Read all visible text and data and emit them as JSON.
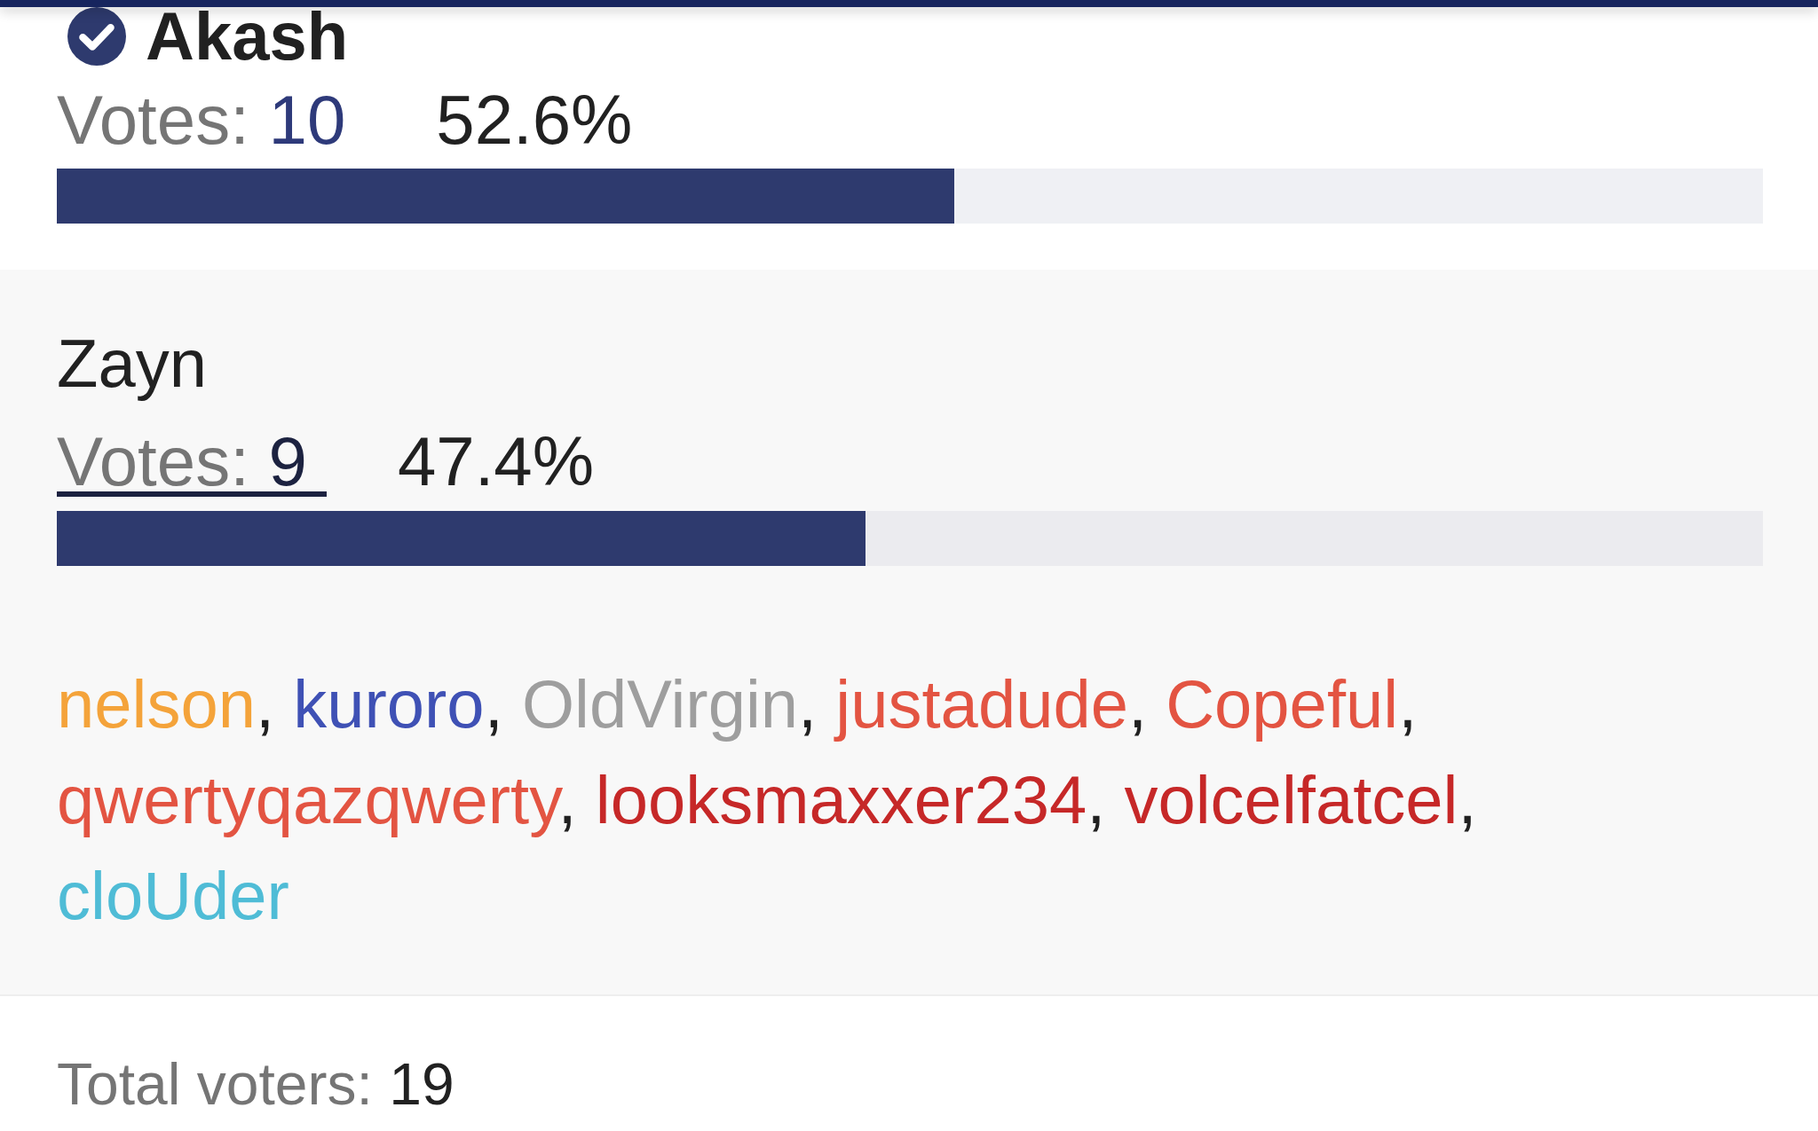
{
  "options": [
    {
      "name": "Akash",
      "selected": true,
      "expanded": false,
      "votes_label": "Votes:",
      "votes": "10",
      "percent": "52.6%",
      "level": 0.526
    },
    {
      "name": "Zayn",
      "selected": false,
      "expanded": true,
      "votes_label": "Votes:",
      "votes": "9",
      "percent": "47.4%",
      "level": 0.474,
      "voter_separator": ",",
      "voters": [
        {
          "name": "nelson",
          "color": "#f4a33a"
        },
        {
          "name": "kuroro",
          "color": "#3f51b5"
        },
        {
          "name": "OldVirgin",
          "color": "#9e9e9e"
        },
        {
          "name": "justadude",
          "color": "#e35442"
        },
        {
          "name": "Copeful",
          "color": "#e35442"
        },
        {
          "name": "qwertyqazqwerty",
          "color": "#e35442"
        },
        {
          "name": "looksmaxxer234",
          "color": "#c62828"
        },
        {
          "name": "volcelfatcel",
          "color": "#c62828"
        },
        {
          "name": "cloUder",
          "color": "#4fbcd6"
        }
      ]
    }
  ],
  "footer": {
    "label": "Total voters:",
    "value": "19"
  }
}
